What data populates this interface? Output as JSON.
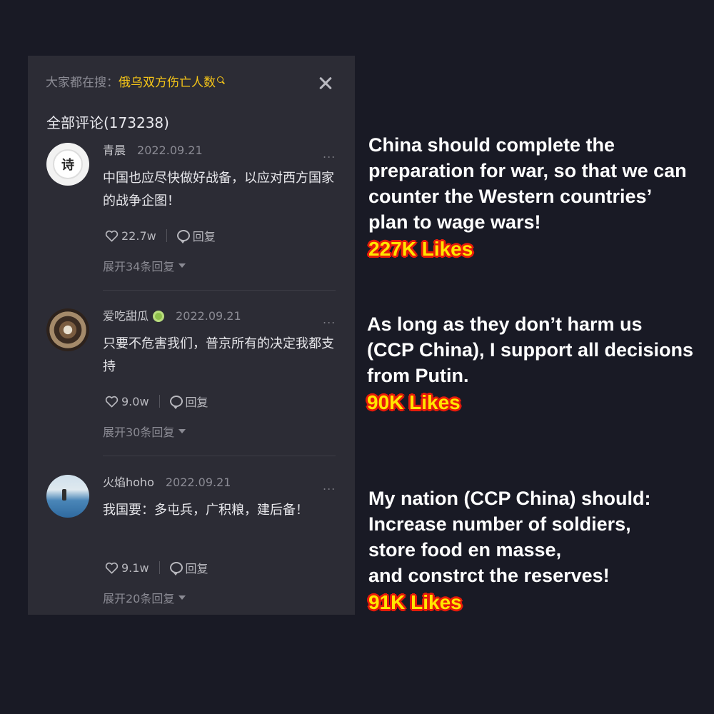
{
  "panel": {
    "search": {
      "prefix": "大家都在搜：",
      "term": "俄乌双方伤亡人数"
    },
    "comments_title": "全部评论(173238)",
    "comments": [
      {
        "avatar_text": "诗",
        "username": "青晨",
        "date": "2022.09.21",
        "more": "...",
        "text": "中国也应尽快做好战备，以应对西方国家的战争企图！",
        "likes": "22.7w",
        "reply_label": "回复",
        "expand_label": "展开34条回复"
      },
      {
        "username": "爱吃甜瓜",
        "date": "2022.09.21",
        "more": "...",
        "text": "只要不危害我们，普京所有的决定我都支持",
        "likes": "9.0w",
        "reply_label": "回复",
        "expand_label": "展开30条回复"
      },
      {
        "username": "火焰hoho",
        "date": "2022.09.21",
        "more": "...",
        "text": "我国要：多屯兵，广积粮，建后备！",
        "likes": "9.1w",
        "reply_label": "回复",
        "expand_label": "展开20条回复"
      }
    ]
  },
  "translations": [
    {
      "text": "China should complete the\npreparation for war, so that we can\ncounter the Western countries’\nplan to wage wars!",
      "likes": "227K Likes"
    },
    {
      "text": "As long as they don’t harm us\n (CCP China), I support all decisions\nfrom Putin.",
      "likes": "90K Likes"
    },
    {
      "text": "My nation (CCP China) should:\nIncrease number of soldiers,\nstore food en masse,\nand constrct the reserves!",
      "likes": "91K Likes"
    }
  ],
  "colors": {
    "background": "#191a25",
    "panel": "#2c2c35",
    "search_term": "#f5c518",
    "likes_fill": "#ffe600",
    "likes_outline": "#e61b0a"
  }
}
